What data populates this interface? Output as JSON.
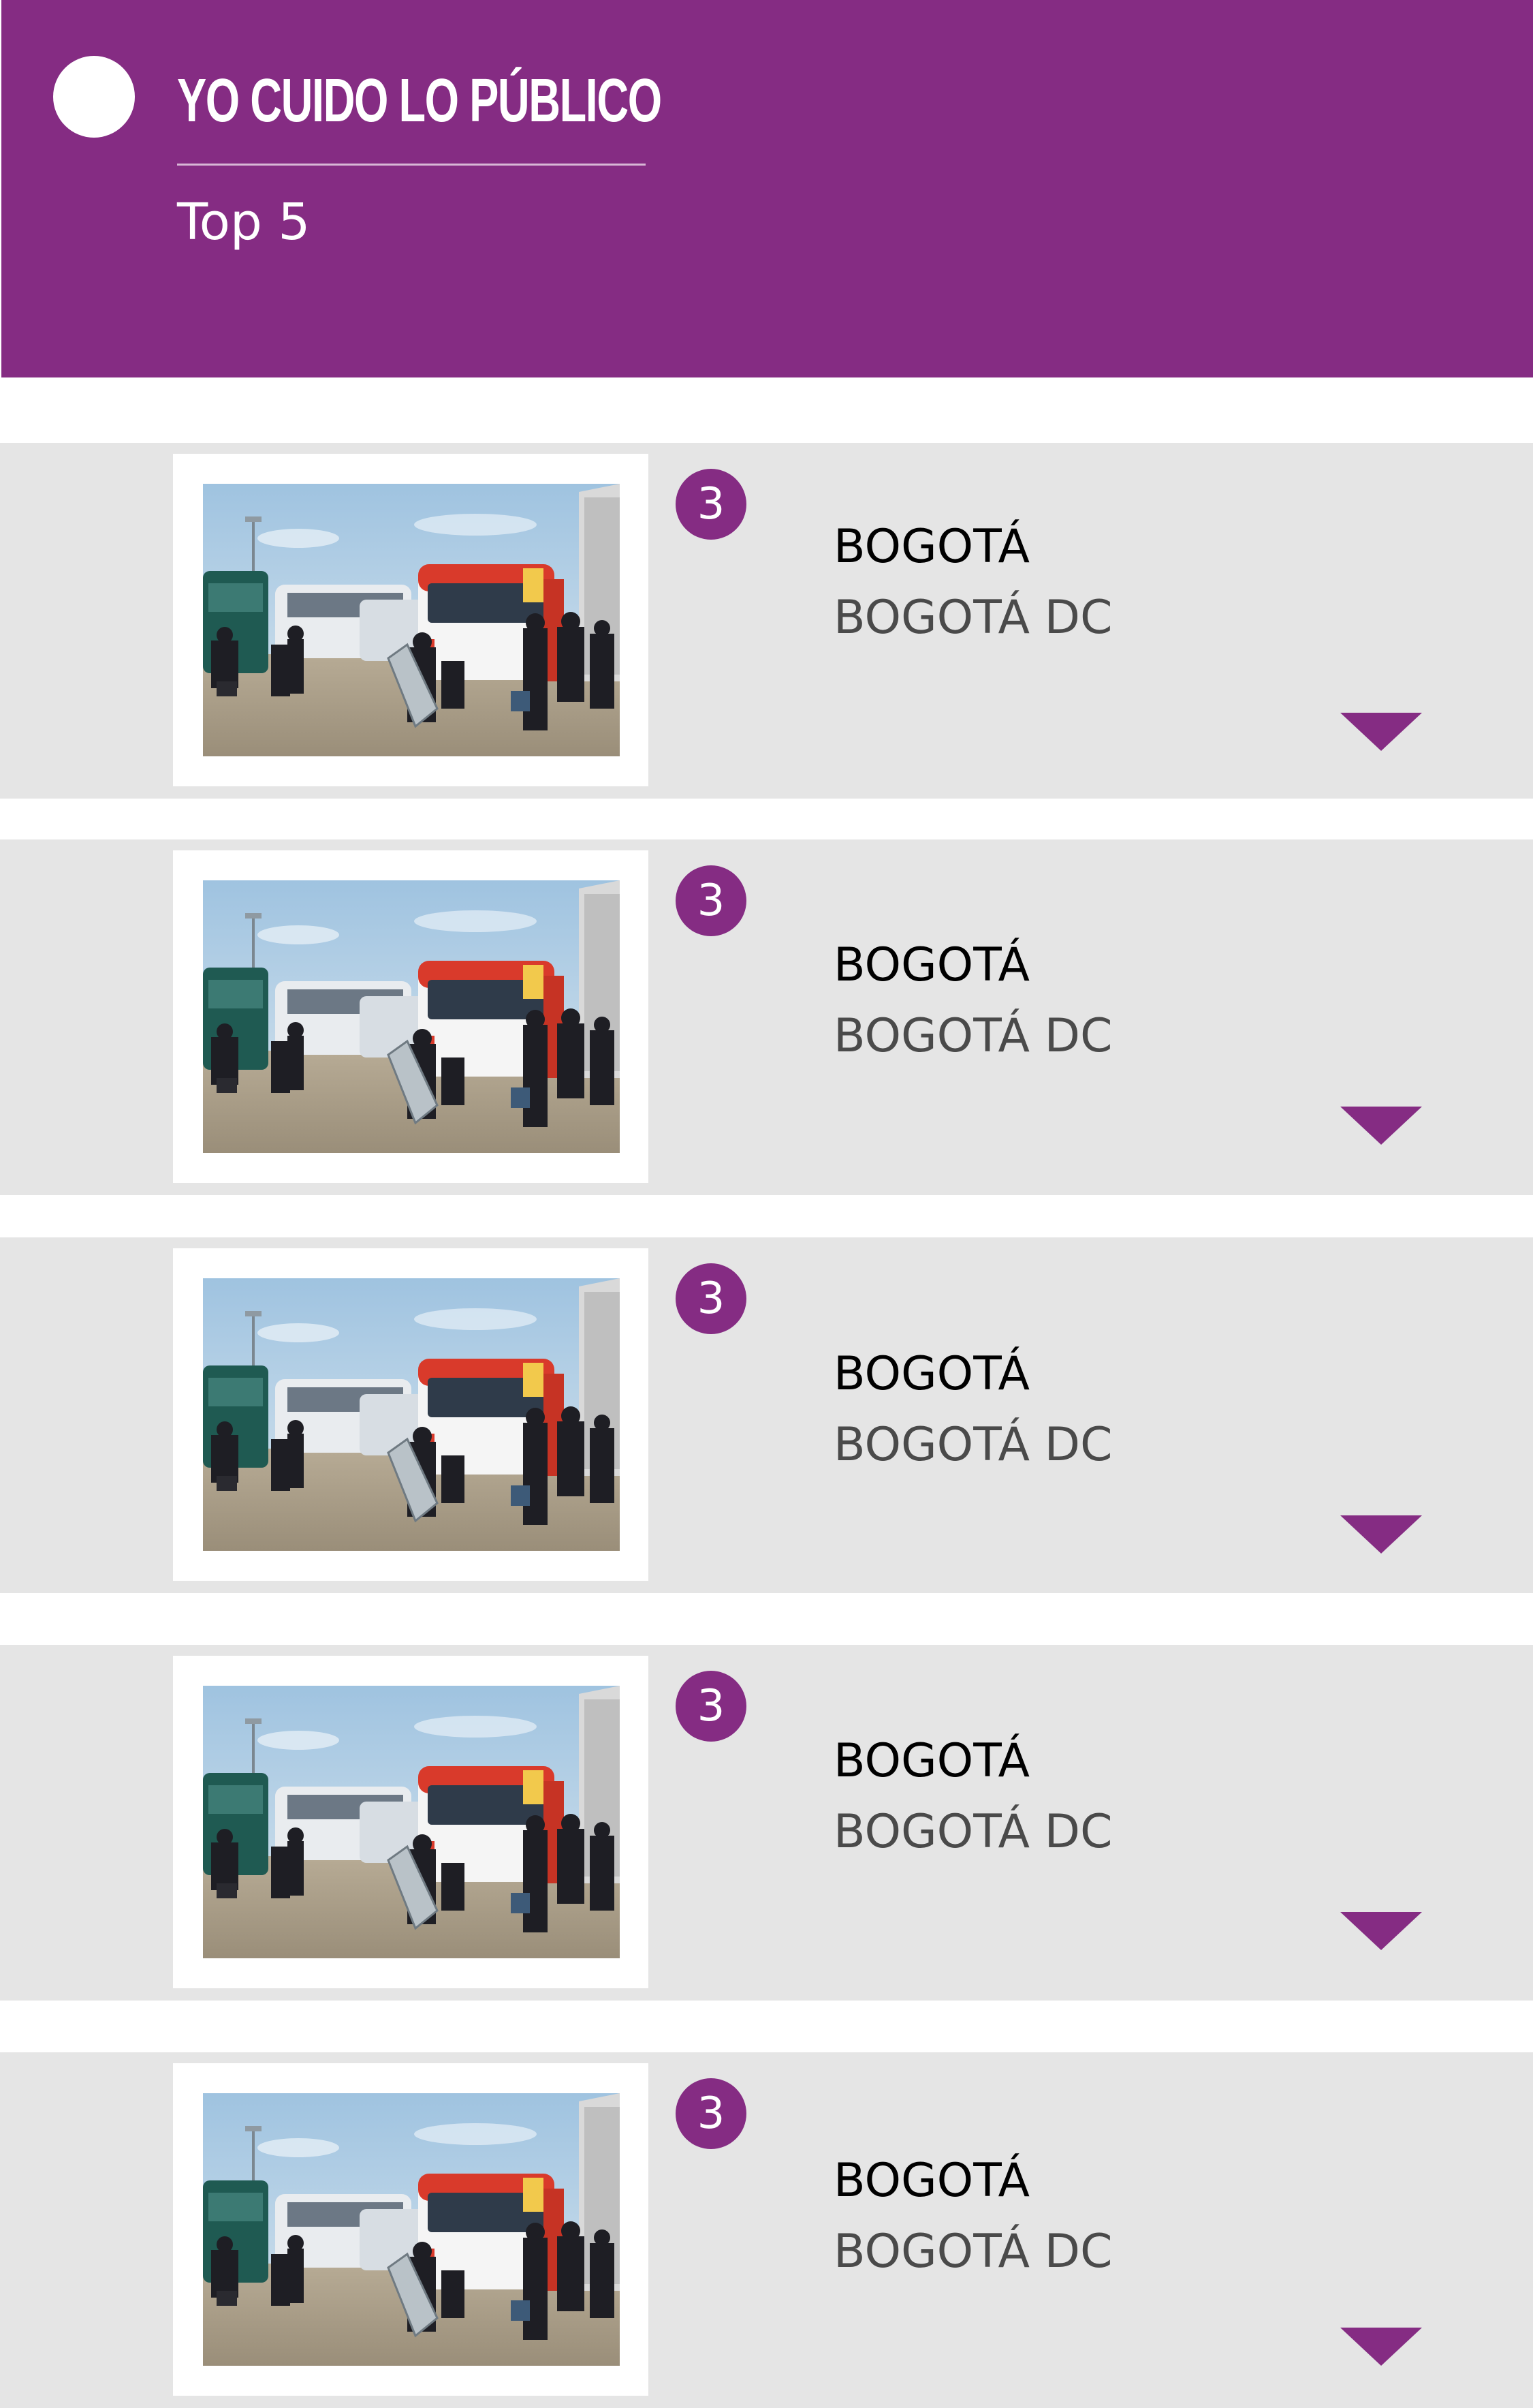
{
  "header": {
    "title": "YO CUIDO LO PÚBLICO",
    "subtitle": "Top 5",
    "accent_color": "#852c83"
  },
  "icons": {
    "logo": "circle-logo-icon",
    "expand": "triangle-down-icon"
  },
  "items": [
    {
      "count": "3",
      "city": "BOGOTÁ",
      "region": "BOGOTÁ DC",
      "photo": "bus-terminal-photo"
    },
    {
      "count": "3",
      "city": "BOGOTÁ",
      "region": "BOGOTÁ DC",
      "photo": "bus-terminal-photo"
    },
    {
      "count": "3",
      "city": "BOGOTÁ",
      "region": "BOGOTÁ DC",
      "photo": "bus-terminal-photo"
    },
    {
      "count": "3",
      "city": "BOGOTÁ",
      "region": "BOGOTÁ DC",
      "photo": "bus-terminal-photo"
    },
    {
      "count": "3",
      "city": "BOGOTÁ",
      "region": "BOGOTÁ DC",
      "photo": "bus-terminal-photo"
    }
  ]
}
